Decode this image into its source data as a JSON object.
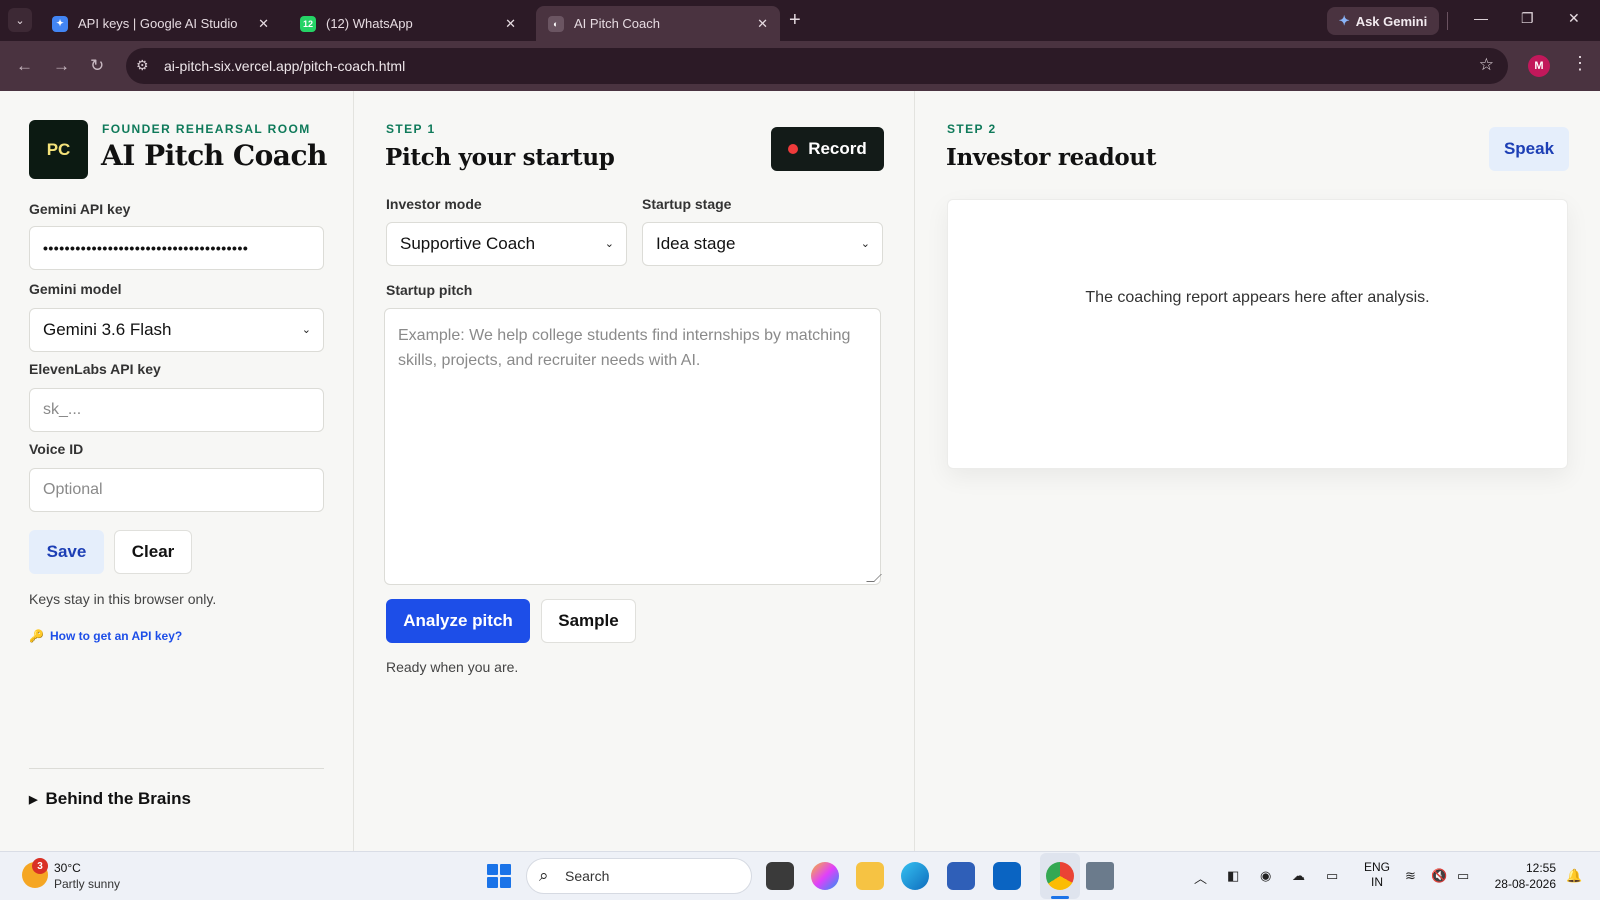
{
  "browser": {
    "tabs": [
      {
        "title": "API keys | Google AI Studio",
        "favicon": "ai-studio-icon",
        "active": false
      },
      {
        "title": "(12) WhatsApp",
        "favicon": "whatsapp-icon",
        "badge": "12",
        "active": false
      },
      {
        "title": "AI Pitch Coach",
        "favicon": "globe-icon",
        "active": true
      }
    ],
    "ask_gemini": "Ask Gemini",
    "url": "ai-pitch-six.vercel.app/pitch-coach.html",
    "profile_initial": "M"
  },
  "sidebar": {
    "logo": "PC",
    "eyebrow": "FOUNDER REHEARSAL ROOM",
    "title": "AI Pitch Coach",
    "gemini_key_label": "Gemini API key",
    "gemini_key_value": "••••••••••••••••••••••••••••••••••••••",
    "gemini_model_label": "Gemini model",
    "gemini_model_value": "Gemini 3.6 Flash",
    "elevenlabs_label": "ElevenLabs API key",
    "elevenlabs_placeholder": "sk_...",
    "voice_label": "Voice ID",
    "voice_placeholder": "Optional",
    "save_label": "Save",
    "clear_label": "Clear",
    "note": "Keys stay in this browser only.",
    "help_link": "How to get an API key?",
    "details_label": "Behind the Brains"
  },
  "step1": {
    "eyebrow": "STEP 1",
    "title": "Pitch your startup",
    "record_label": "Record",
    "mode_label": "Investor mode",
    "mode_value": "Supportive Coach",
    "stage_label": "Startup stage",
    "stage_value": "Idea stage",
    "pitch_label": "Startup pitch",
    "pitch_placeholder": "Example: We help college students find internships by matching skills, projects, and recruiter needs with AI.",
    "analyze_label": "Analyze pitch",
    "sample_label": "Sample",
    "status": "Ready when you are."
  },
  "step2": {
    "eyebrow": "STEP 2",
    "title": "Investor readout",
    "speak_label": "Speak",
    "empty_text": "The coaching report appears here after analysis."
  },
  "taskbar": {
    "weather_badge": "3",
    "temperature": "30°C",
    "weather": "Partly sunny",
    "search_label": "Search",
    "lang_1": "ENG",
    "lang_2": "IN",
    "time": "12:55",
    "date": "28-08-2026"
  },
  "colors": {
    "accent": "#1d4ee8",
    "eyebrow": "#0f7a5a",
    "record_dot": "#ef3b3b",
    "chrome_dark": "#2c1a26"
  }
}
